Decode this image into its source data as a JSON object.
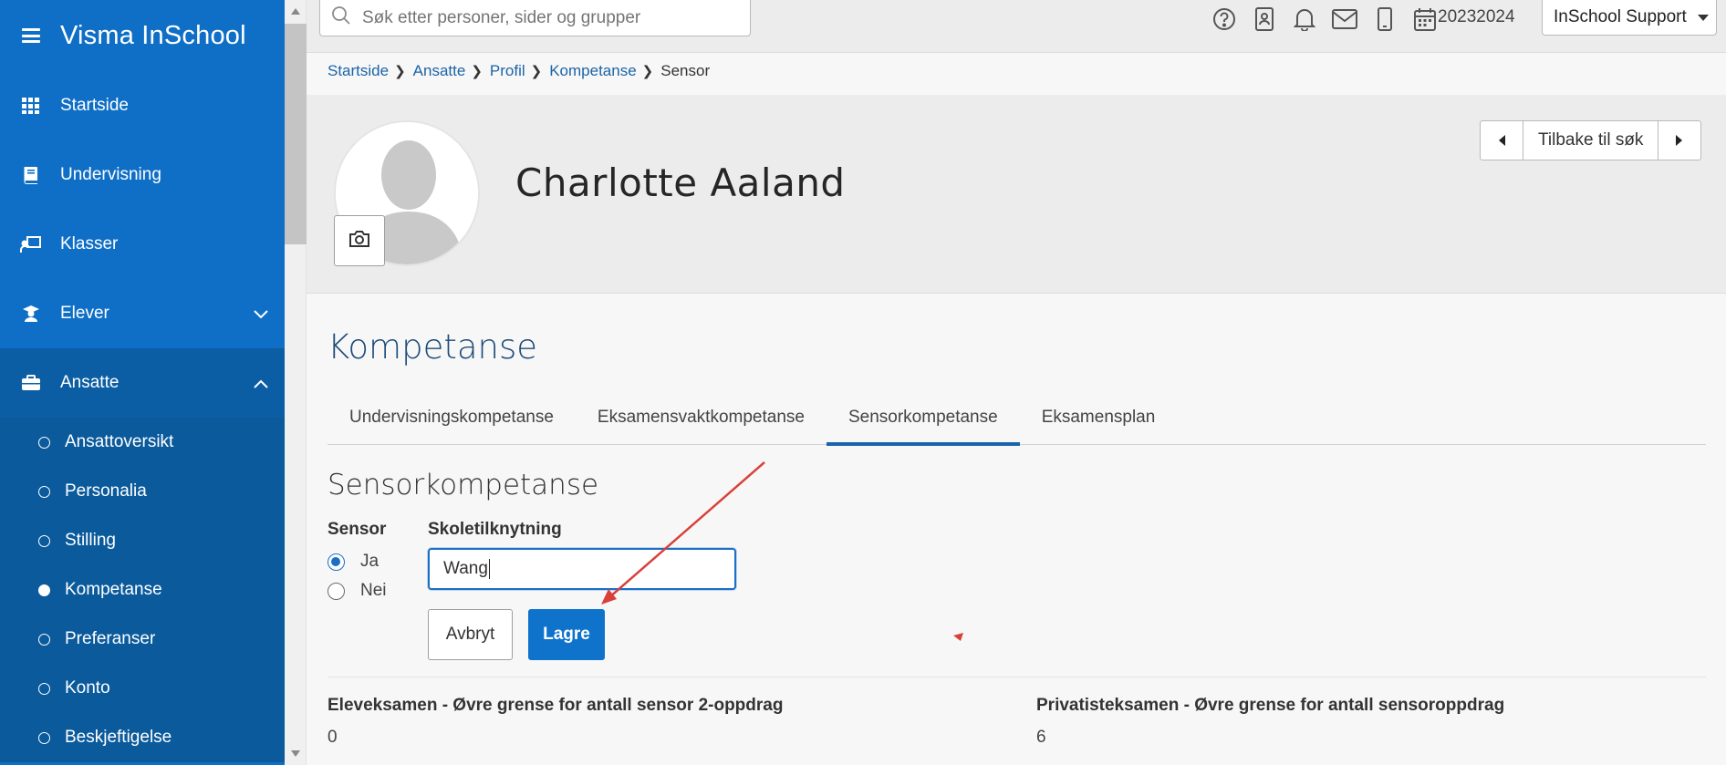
{
  "app": {
    "title": "Visma InSchool"
  },
  "sidebar": {
    "items": [
      {
        "label": "Startside",
        "icon": "grid-icon"
      },
      {
        "label": "Undervisning",
        "icon": "book-icon"
      },
      {
        "label": "Klasser",
        "icon": "classroom-icon"
      },
      {
        "label": "Elever",
        "icon": "student-icon"
      },
      {
        "label": "Ansatte",
        "icon": "briefcase-icon"
      }
    ],
    "subitems": [
      {
        "label": "Ansattoversikt"
      },
      {
        "label": "Personalia"
      },
      {
        "label": "Stilling"
      },
      {
        "label": "Kompetanse"
      },
      {
        "label": "Preferanser"
      },
      {
        "label": "Konto"
      },
      {
        "label": "Beskjeftigelse"
      }
    ]
  },
  "topbar": {
    "search_placeholder": "Søk etter personer, sider og grupper",
    "year": "20232024",
    "user": "InSchool Support"
  },
  "breadcrumb": [
    "Startside",
    "Ansatte",
    "Profil",
    "Kompetanse",
    "Sensor"
  ],
  "profile": {
    "name": "Charlotte Aaland",
    "back_label": "Tilbake til søk"
  },
  "content": {
    "title": "Kompetanse",
    "tabs": [
      "Undervisningskompetanse",
      "Eksamensvaktkompetanse",
      "Sensorkompetanse",
      "Eksamensplan"
    ],
    "active_tab": "Sensorkompetanse",
    "section_title": "Sensorkompetanse",
    "sensor_label": "Sensor",
    "radio_yes": "Ja",
    "radio_no": "Nei",
    "school_label": "Skoletilknytning",
    "school_value": "Wang",
    "cancel_label": "Avbryt",
    "save_label": "Lagre",
    "info": [
      {
        "label": "Eleveksamen - Øvre grense for antall sensor 2-oppdrag",
        "value": "0"
      },
      {
        "label": "Privatisteksamen - Øvre grense for antall sensoroppdrag",
        "value": "6"
      }
    ]
  },
  "colors": {
    "sidebar": "#0f6fc6",
    "sidebar_sub": "#0a5a9c",
    "accent": "#0f73cc",
    "annotation": "#d9403a"
  }
}
